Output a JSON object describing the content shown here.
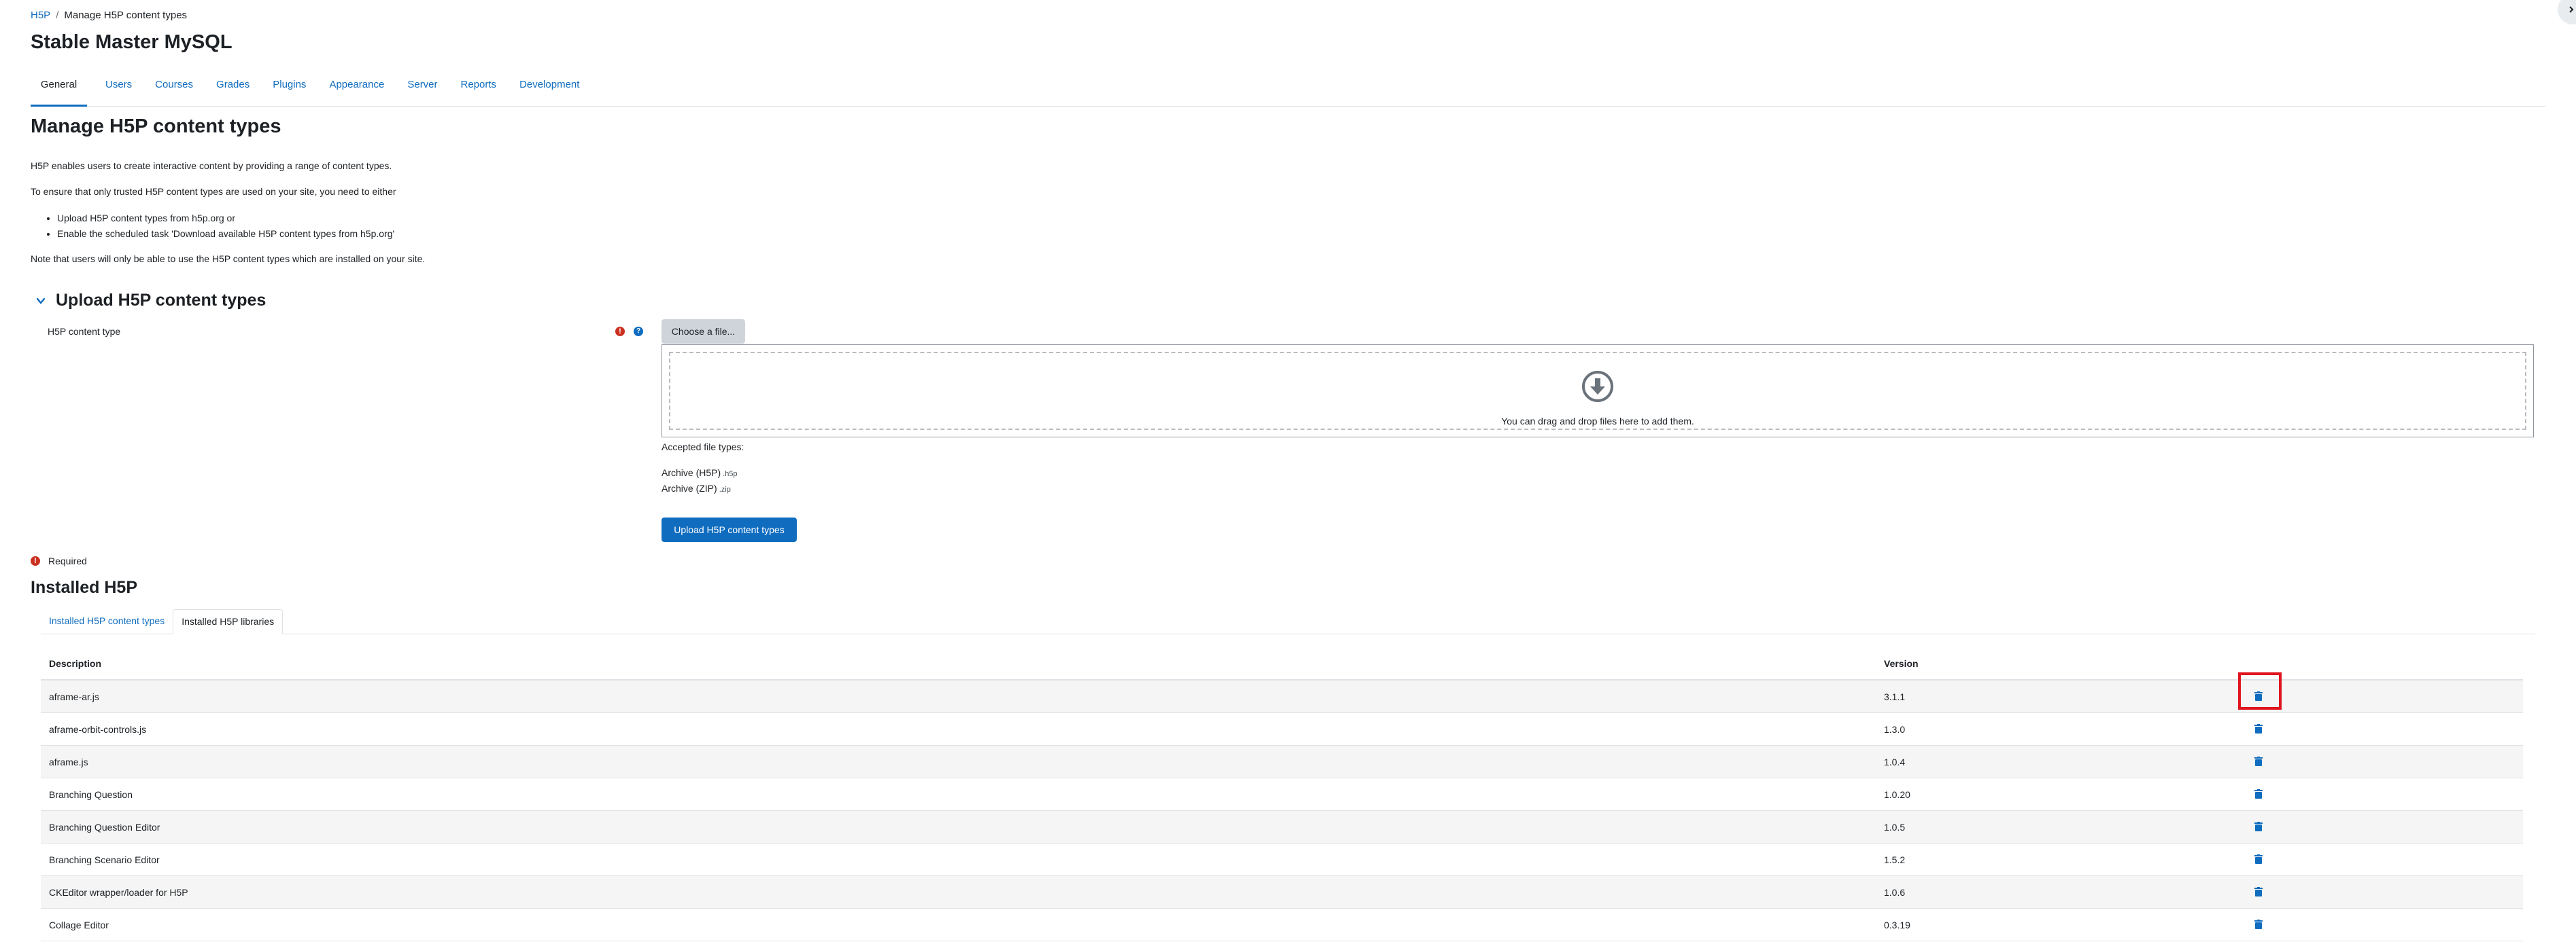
{
  "breadcrumb": {
    "root": "H5P",
    "separator": "/",
    "current": "Manage H5P content types"
  },
  "site": {
    "title": "Stable Master MySQL"
  },
  "nav": {
    "tabs": [
      {
        "label": "General"
      },
      {
        "label": "Users"
      },
      {
        "label": "Courses"
      },
      {
        "label": "Grades"
      },
      {
        "label": "Plugins"
      },
      {
        "label": "Appearance"
      },
      {
        "label": "Server"
      },
      {
        "label": "Reports"
      },
      {
        "label": "Development"
      }
    ]
  },
  "page": {
    "heading": "Manage H5P content types",
    "intro": "H5P enables users to create interactive content by providing a range of content types.",
    "ensure": "To ensure that only trusted H5P content types are used on your site, you need to either",
    "bullets": [
      "Upload H5P content types from h5p.org or",
      "Enable the scheduled task 'Download available H5P content types from h5p.org'"
    ],
    "note": "Note that users will only be able to use the H5P content types which are installed on your site."
  },
  "upload": {
    "section_title": "Upload H5P content types",
    "field_label": "H5P content type",
    "required_icon": "!",
    "help_icon": "?",
    "choose_button": "Choose a file...",
    "dropzone_text": "You can drag and drop files here to add them.",
    "accepted_label": "Accepted file types:",
    "file_types": [
      {
        "name": "Archive (H5P)",
        "ext": ".h5p"
      },
      {
        "name": "Archive (ZIP)",
        "ext": ".zip"
      }
    ],
    "submit_button": "Upload H5P content types",
    "required_note": "Required"
  },
  "installed": {
    "title": "Installed H5P",
    "tabs": [
      {
        "label": "Installed H5P content types"
      },
      {
        "label": "Installed H5P libraries"
      }
    ],
    "columns": {
      "description": "Description",
      "version": "Version"
    },
    "rows": [
      {
        "description": "aframe-ar.js",
        "version": "3.1.1"
      },
      {
        "description": "aframe-orbit-controls.js",
        "version": "1.3.0"
      },
      {
        "description": "aframe.js",
        "version": "1.0.4"
      },
      {
        "description": "Branching Question",
        "version": "1.0.20"
      },
      {
        "description": "Branching Question Editor",
        "version": "1.0.5"
      },
      {
        "description": "Branching Scenario Editor",
        "version": "1.5.2"
      },
      {
        "description": "CKEditor wrapper/loader for H5P",
        "version": "1.0.6"
      },
      {
        "description": "Collage Editor",
        "version": "0.3.19"
      }
    ]
  },
  "colors": {
    "accent": "#0f6cbf",
    "required": "#ca3120",
    "highlight": "#e0141e"
  }
}
